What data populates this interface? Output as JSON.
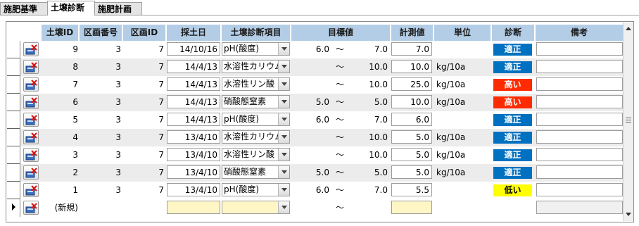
{
  "tabs": [
    {
      "label": "施肥基準",
      "active": false
    },
    {
      "label": "土壌診断",
      "active": true
    },
    {
      "label": "施肥計画",
      "active": false
    }
  ],
  "columns": {
    "soil_id": "土壌ID",
    "section_number": "区画番号",
    "section_id": "区画ID",
    "sample_date": "採土日",
    "item": "土壌診断項目",
    "target": "目標値",
    "measured": "計測値",
    "unit": "単位",
    "diagnosis": "診断",
    "notes": "備考"
  },
  "colors": {
    "header_bg": "#b3cde6",
    "row_alt_bg": "#ececec",
    "badge_ok": "#0070c0",
    "badge_high": "#ff2b00",
    "badge_low": "#ffff00",
    "new_row_field": "#fff6c6"
  },
  "icons": {
    "row_edit": "edit-delete-record-icon",
    "current_row": "current-record-pointer-icon"
  },
  "rows": [
    {
      "soil_id": "9",
      "section_number": "3",
      "section_id": "7",
      "sample_date": "14/10/16",
      "item": "pH(酸度)",
      "target_min": "6.0",
      "tilde": "～",
      "target_max": "7.0",
      "measured": "7.0",
      "unit": "",
      "diagnosis": "適正",
      "diagnosis_type": "ok",
      "notes": ""
    },
    {
      "soil_id": "8",
      "section_number": "3",
      "section_id": "7",
      "sample_date": "14/4/13",
      "item": "水溶性カリウム",
      "target_min": "",
      "tilde": "～",
      "target_max": "10.0",
      "measured": "10.0",
      "unit": "kg/10a",
      "diagnosis": "適正",
      "diagnosis_type": "ok",
      "notes": ""
    },
    {
      "soil_id": "7",
      "section_number": "3",
      "section_id": "7",
      "sample_date": "14/4/13",
      "item": "水溶性リン酸",
      "target_min": "",
      "tilde": "～",
      "target_max": "10.0",
      "measured": "25.0",
      "unit": "kg/10a",
      "diagnosis": "高い",
      "diagnosis_type": "high",
      "notes": ""
    },
    {
      "soil_id": "6",
      "section_number": "3",
      "section_id": "7",
      "sample_date": "14/4/13",
      "item": "硝酸態窒素",
      "target_min": "5.0",
      "tilde": "～",
      "target_max": "5.0",
      "measured": "10.0",
      "unit": "kg/10a",
      "diagnosis": "高い",
      "diagnosis_type": "high",
      "notes": ""
    },
    {
      "soil_id": "5",
      "section_number": "3",
      "section_id": "7",
      "sample_date": "14/4/13",
      "item": "pH(酸度)",
      "target_min": "6.0",
      "tilde": "～",
      "target_max": "7.0",
      "measured": "6.0",
      "unit": "",
      "diagnosis": "適正",
      "diagnosis_type": "ok",
      "notes": ""
    },
    {
      "soil_id": "4",
      "section_number": "3",
      "section_id": "7",
      "sample_date": "13/4/10",
      "item": "水溶性カリウム",
      "target_min": "",
      "tilde": "～",
      "target_max": "10.0",
      "measured": "5.0",
      "unit": "kg/10a",
      "diagnosis": "適正",
      "diagnosis_type": "ok",
      "notes": ""
    },
    {
      "soil_id": "3",
      "section_number": "3",
      "section_id": "7",
      "sample_date": "13/4/10",
      "item": "水溶性リン酸",
      "target_min": "",
      "tilde": "～",
      "target_max": "10.0",
      "measured": "5.0",
      "unit": "kg/10a",
      "diagnosis": "適正",
      "diagnosis_type": "ok",
      "notes": ""
    },
    {
      "soil_id": "2",
      "section_number": "3",
      "section_id": "7",
      "sample_date": "13/4/10",
      "item": "硝酸態窒素",
      "target_min": "5.0",
      "tilde": "～",
      "target_max": "5.0",
      "measured": "5.0",
      "unit": "kg/10a",
      "diagnosis": "適正",
      "diagnosis_type": "ok",
      "notes": ""
    },
    {
      "soil_id": "1",
      "section_number": "3",
      "section_id": "7",
      "sample_date": "13/4/10",
      "item": "pH(酸度)",
      "target_min": "6.0",
      "tilde": "～",
      "target_max": "7.0",
      "measured": "5.5",
      "unit": "",
      "diagnosis": "低い",
      "diagnosis_type": "low",
      "notes": ""
    }
  ],
  "new_row": {
    "label": "(新規)",
    "tilde": "～"
  }
}
